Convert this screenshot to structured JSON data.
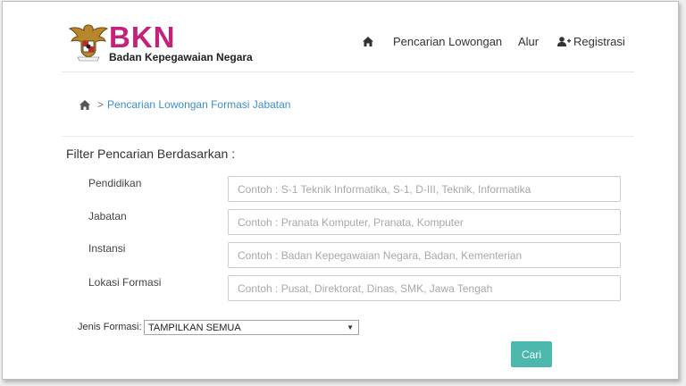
{
  "header": {
    "brand": "BKN",
    "brand_sub": "Badan Kepegawaian Negara",
    "nav": {
      "home_icon": "home-icon",
      "pencarian": "Pencarian Lowongan",
      "alur": "Alur",
      "registrasi_icon": "user-plus-icon",
      "registrasi": "Registrasi"
    },
    "accent_color": "#c3217c"
  },
  "breadcrumb": {
    "home_icon": "home-icon",
    "separator": ">",
    "current": "Pencarian Lowongan Formasi Jabatan"
  },
  "filter": {
    "title": "Filter Pencarian Berdasarkan :",
    "fields": [
      {
        "label": "Pendidikan",
        "value": "",
        "placeholder": "Contoh : S-1 Teknik Informatika, S-1, D-III, Teknik, Informatika"
      },
      {
        "label": "Jabatan",
        "value": "",
        "placeholder": "Contoh : Pranata Komputer, Pranata, Komputer"
      },
      {
        "label": "Instansi",
        "value": "",
        "placeholder": "Contoh : Badan Kepegawaian Negara, Badan, Kementerian"
      },
      {
        "label": "Lokasi Formasi",
        "value": "",
        "placeholder": "Contoh : Pusat, Direktorat, Dinas, SMK, Jawa Tengah"
      }
    ],
    "jenis_label": "Jenis Formasi:",
    "jenis_selected": "TAMPILKAN SEMUA",
    "submit_label": "Cari",
    "submit_color": "#4cb8ad"
  }
}
